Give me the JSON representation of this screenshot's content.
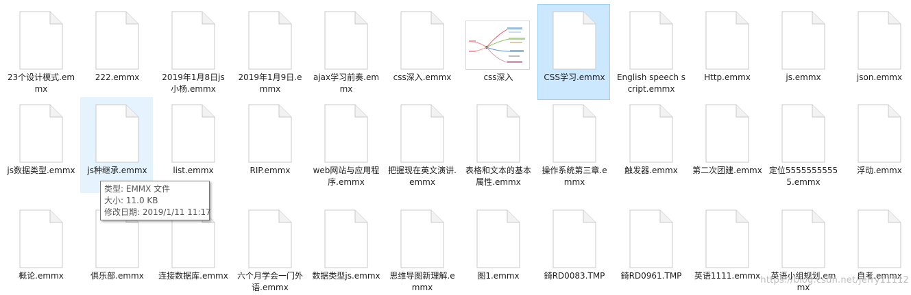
{
  "files": [
    {
      "label": "23个设计模式.emmx",
      "icon": "document-icon"
    },
    {
      "label": "222.emmx",
      "icon": "document-icon"
    },
    {
      "label": "2019年1月8日js小杨.emmx",
      "icon": "document-icon"
    },
    {
      "label": "2019年1月9日.emmx",
      "icon": "document-icon"
    },
    {
      "label": "ajax学习前奏.emmx",
      "icon": "document-icon"
    },
    {
      "label": "css深入.emmx",
      "icon": "document-icon"
    },
    {
      "label": "css深入",
      "icon": "mindmap-thumbnail"
    },
    {
      "label": "CSS学习.emmx",
      "icon": "document-icon",
      "selected": true
    },
    {
      "label": "English speech script.emmx",
      "icon": "document-icon"
    },
    {
      "label": "Http.emmx",
      "icon": "document-icon"
    },
    {
      "label": "js.emmx",
      "icon": "document-icon"
    },
    {
      "label": "json.emmx",
      "icon": "document-icon"
    },
    {
      "label": "js数据类型.emmx",
      "icon": "document-icon"
    },
    {
      "label": "js种继承.emmx",
      "icon": "document-icon",
      "hovered": true
    },
    {
      "label": "list.emmx",
      "icon": "document-icon"
    },
    {
      "label": "RIP.emmx",
      "icon": "document-icon"
    },
    {
      "label": "web网站与应用程序.emmx",
      "icon": "document-icon"
    },
    {
      "label": "把握现在英文演讲.emmx",
      "icon": "document-icon"
    },
    {
      "label": "表格和文本的基本属性.emmx",
      "icon": "document-icon"
    },
    {
      "label": "操作系统第三章.emmx",
      "icon": "document-icon"
    },
    {
      "label": "触发器.emmx",
      "icon": "document-icon"
    },
    {
      "label": "第二次团建.emmx",
      "icon": "document-icon"
    },
    {
      "label": "定位55555555555.emmx",
      "icon": "document-icon"
    },
    {
      "label": "浮动.emmx",
      "icon": "document-icon"
    },
    {
      "label": "概论.emmx",
      "icon": "document-icon"
    },
    {
      "label": "俱乐部.emmx",
      "icon": "document-icon"
    },
    {
      "label": "连接数据库.emmx",
      "icon": "document-icon"
    },
    {
      "label": "六个月学会一门外语.emmx",
      "icon": "document-icon"
    },
    {
      "label": "数据类型js.emmx",
      "icon": "document-icon"
    },
    {
      "label": "思维导图新理解.emmx",
      "icon": "document-icon"
    },
    {
      "label": "图1.emmx",
      "icon": "document-icon"
    },
    {
      "label": "錡RD0083.TMP",
      "icon": "document-icon"
    },
    {
      "label": "錡RD0961.TMP",
      "icon": "document-icon"
    },
    {
      "label": "英语1111.emmx",
      "icon": "document-icon"
    },
    {
      "label": "英语小组规划.emmx",
      "icon": "document-icon"
    },
    {
      "label": "自考.emmx",
      "icon": "document-icon"
    }
  ],
  "tooltip": {
    "type": "类型: EMMX 文件",
    "size": "大小: 11.0 KB",
    "modified": "修改日期: 2019/1/11 11:17"
  },
  "watermark": "https://blog.csdn.net/jerry11112",
  "colors": {
    "selected_bg": "#cce8ff",
    "selected_border": "#99d1ff",
    "hover_bg": "#e5f3ff",
    "tooltip_border": "#767676"
  }
}
